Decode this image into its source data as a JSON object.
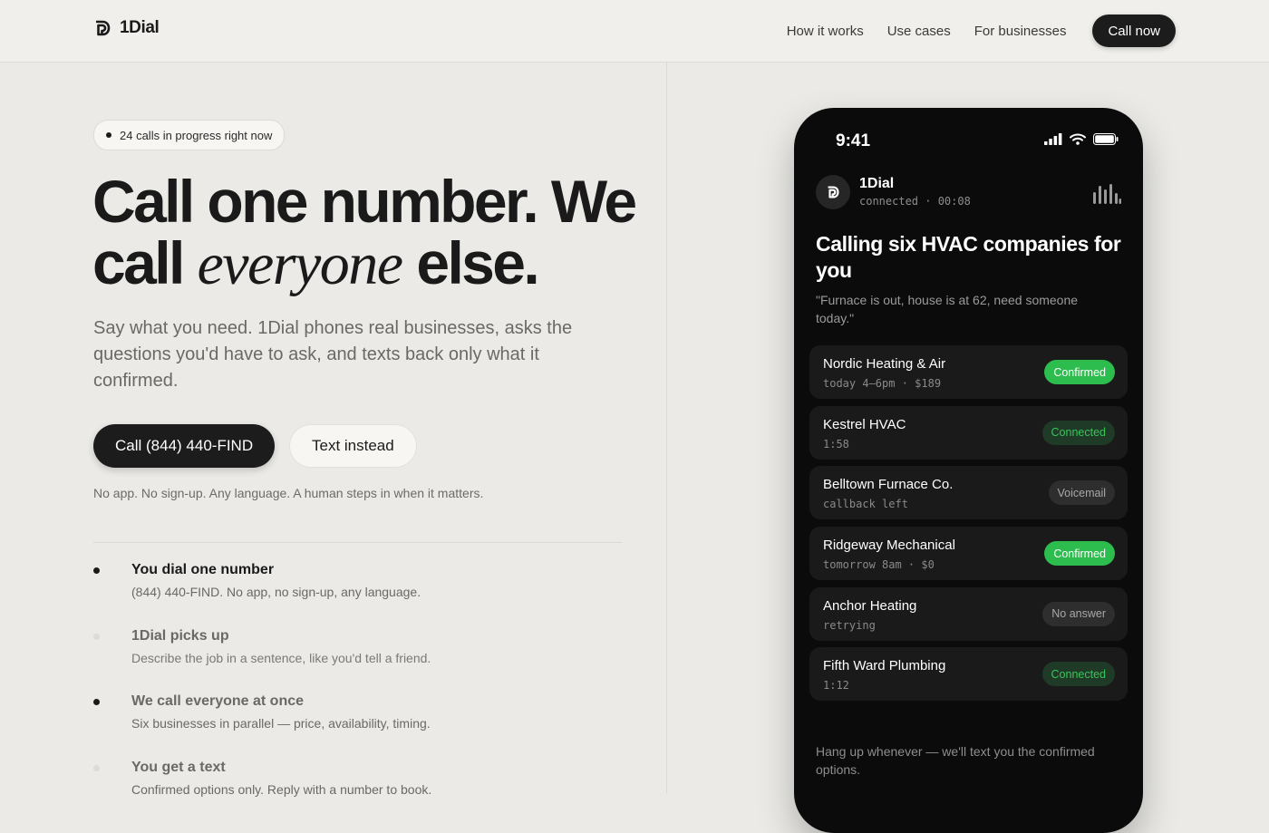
{
  "brand": {
    "name": "1Dial"
  },
  "nav": {
    "links": [
      "How it works",
      "Use cases",
      "For businesses"
    ],
    "cta": "Call now"
  },
  "hero": {
    "live_pill": "24 calls in progress right now",
    "headline_a": "Call one number. We call",
    "headline_italic": "everyone",
    "headline_b": "else.",
    "subtitle": "Say what you need. 1Dial phones real businesses, asks the questions you'd have to ask, and texts back only what it confirmed.",
    "primary_cta": "Call (844) 440-FIND",
    "secondary_cta": "Text instead",
    "fine_print": "No app. No sign-up. Any language. A human steps in when it matters."
  },
  "steps": [
    {
      "title": "You dial one number",
      "desc": "(844) 440-FIND. No app, no sign-up, any language."
    },
    {
      "title": "1Dial picks up",
      "desc": "Describe the job in a sentence, like you'd tell a friend."
    },
    {
      "title": "We call everyone at once",
      "desc": "Six businesses in parallel — price, availability, timing."
    },
    {
      "title": "You get a text",
      "desc": "Confirmed options only. Reply with a number to book."
    }
  ],
  "phone": {
    "time": "9:41",
    "caller_name": "1Dial",
    "call_status": "connected · 00:08",
    "heading": "Calling six HVAC companies for you",
    "quote": "\"Furnace is out, house is at 62, need someone today.\"",
    "businesses": [
      {
        "name": "Nordic Heating & Air",
        "detail": "today 4–6pm · $189",
        "status": "Confirmed",
        "kind": "confirmed"
      },
      {
        "name": "Kestrel HVAC",
        "detail": "1:58",
        "status": "Connected",
        "kind": "connected"
      },
      {
        "name": "Belltown Furnace Co.",
        "detail": "callback left",
        "status": "Voicemail",
        "kind": "muted"
      },
      {
        "name": "Ridgeway Mechanical",
        "detail": "tomorrow 8am · $0",
        "status": "Confirmed",
        "kind": "confirmed"
      },
      {
        "name": "Anchor Heating",
        "detail": "retrying",
        "status": "No answer",
        "kind": "muted"
      },
      {
        "name": "Fifth Ward Plumbing",
        "detail": "1:12",
        "status": "Connected",
        "kind": "connected"
      }
    ],
    "footer": "Hang up whenever — we'll text you the confirmed options."
  },
  "colors": {
    "background": "#ebeae6",
    "ink": "#1a1a1a",
    "confirmed_green": "#2dbd4e",
    "connected_green": "#39c45b",
    "phone_bg": "#0b0b0b"
  },
  "icons": [
    "logo-mark-icon",
    "signal-icon",
    "wifi-icon",
    "battery-icon",
    "audio-wave-icon"
  ]
}
